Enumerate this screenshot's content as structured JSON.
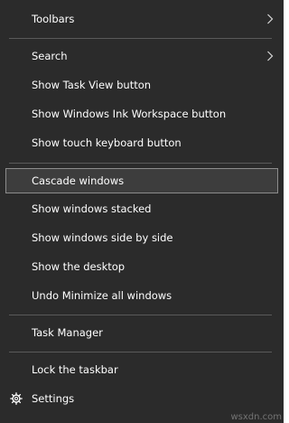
{
  "menu": {
    "toolbars": "Toolbars",
    "search": "Search",
    "show_task_view": "Show Task View button",
    "show_ink_workspace": "Show Windows Ink Workspace button",
    "show_touch_keyboard": "Show touch keyboard button",
    "cascade": "Cascade windows",
    "stacked": "Show windows stacked",
    "side_by_side": "Show windows side by side",
    "show_desktop": "Show the desktop",
    "undo_minimize": "Undo Minimize all windows",
    "task_manager": "Task Manager",
    "lock_taskbar": "Lock the taskbar",
    "settings": "Settings"
  },
  "icons": {
    "submenu": "chevron-right-icon",
    "settings": "gear-icon"
  },
  "colors": {
    "background": "#2b2b2b",
    "text": "#ffffff",
    "hover_background": "#3d3d3d",
    "hover_border": "#8c8c8c",
    "separator": "#5a5a5a"
  },
  "watermark": "wsxdn.com"
}
